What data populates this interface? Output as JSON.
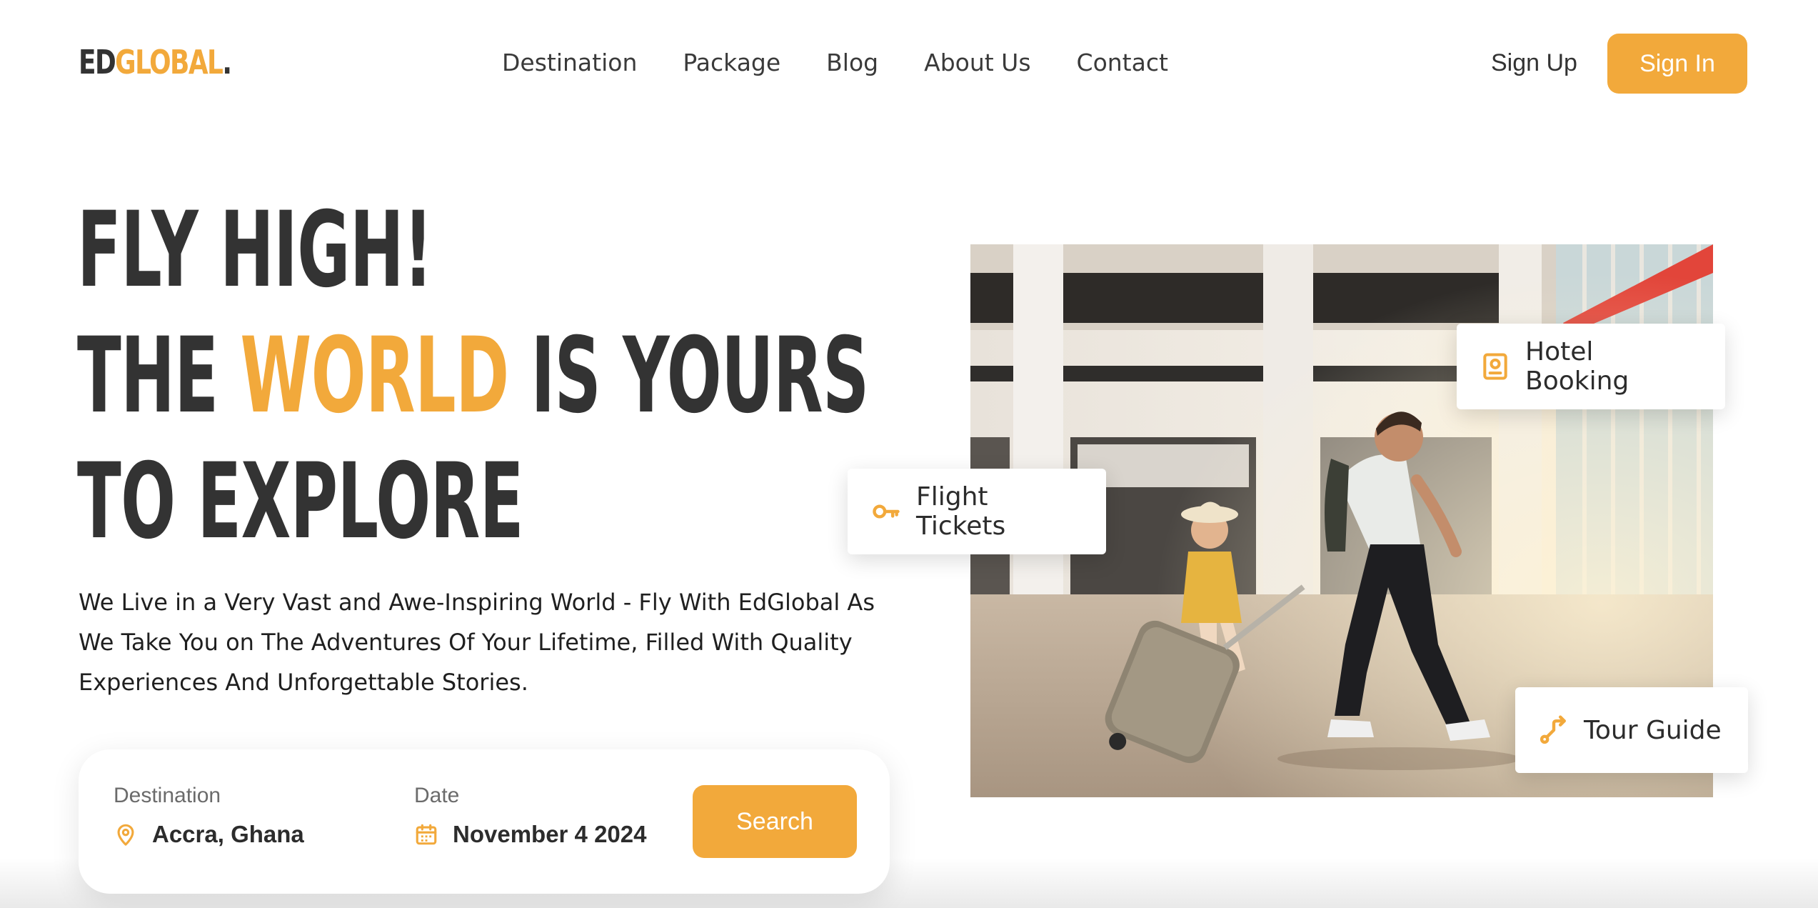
{
  "brand": {
    "logo_ed": "ED",
    "logo_global": "GLOBAL",
    "logo_dot": ".",
    "accent_color": "#f2a93b",
    "text_color": "#333333"
  },
  "nav": {
    "items": [
      "Destination",
      "Package",
      "Blog",
      "About Us",
      "Contact"
    ],
    "signup_label": "Sign Up",
    "signin_label": "Sign In"
  },
  "hero": {
    "line1": "FLY HIGH!",
    "line2_pre": "THE ",
    "line2_accent": "WORLD",
    "line2_post": " IS YOURS",
    "line3": "TO EXPLORE",
    "description": "We Live in a Very Vast and Awe-Inspiring World - Fly With EdGlobal As We Take You on The Adventures Of Your Lifetime, Filled With Quality Experiences And Unforgettable Stories."
  },
  "search": {
    "destination_label": "Destination",
    "destination_value": "Accra, Ghana",
    "destination_icon": "map-pin-icon",
    "date_label": "Date",
    "date_value": "November 4 2024",
    "date_icon": "calendar-icon",
    "button_label": "Search"
  },
  "badges": {
    "hotel": {
      "label": "Hotel Booking",
      "icon": "hotel-id-icon"
    },
    "flight": {
      "label": "Flight Tickets",
      "icon": "key-icon"
    },
    "tour": {
      "label": "Tour Guide",
      "icon": "route-icon"
    }
  }
}
